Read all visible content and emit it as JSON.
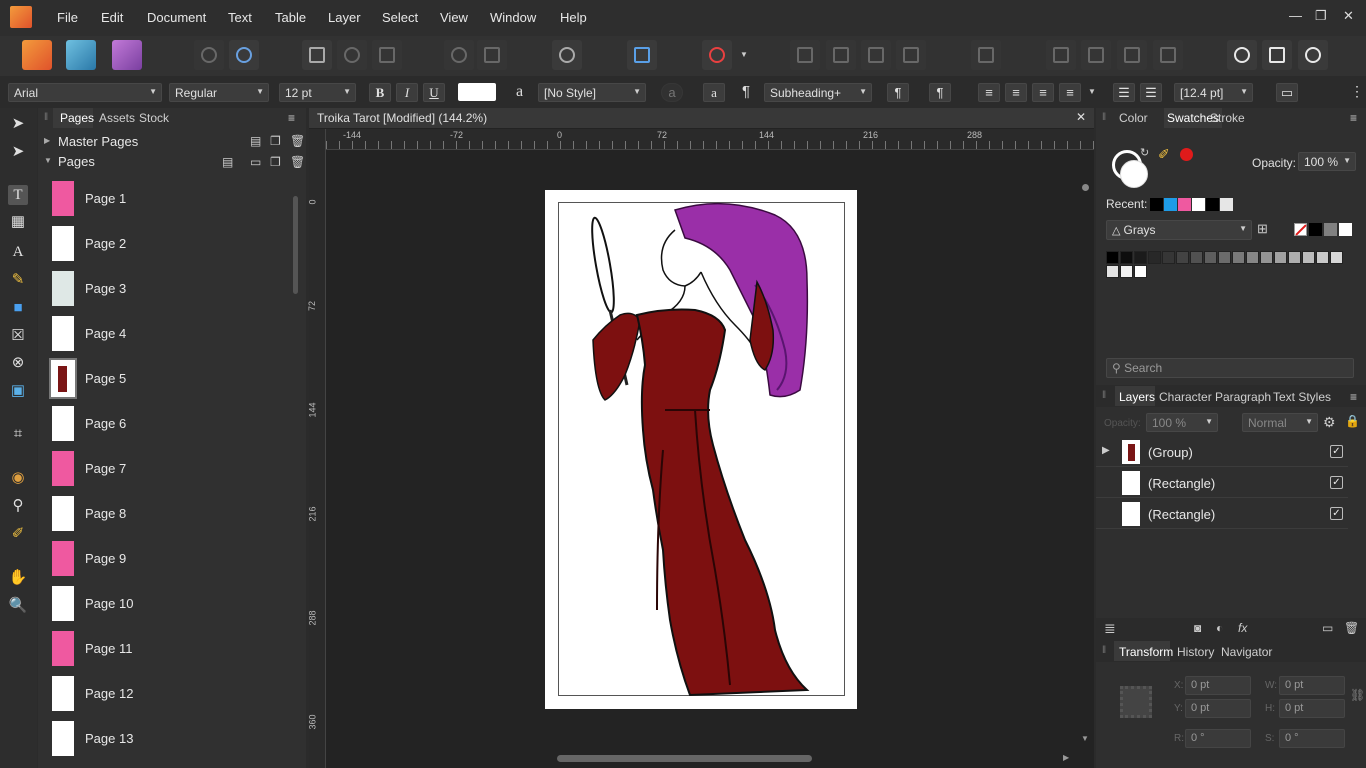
{
  "menu": [
    "File",
    "Edit",
    "Document",
    "Text",
    "Table",
    "Layer",
    "Select",
    "View",
    "Window",
    "Help"
  ],
  "context": {
    "font": "Arial",
    "weight": "Regular",
    "size": "12 pt",
    "bold": "B",
    "italic": "I",
    "underline": "U",
    "char_style_glyph": "a",
    "char_style": "[No Style]",
    "para_style": "Subheading+",
    "pilcrow": "¶",
    "leading": "[12.4 pt]"
  },
  "pages_panel": {
    "tabs": [
      "Pages",
      "Assets",
      "Stock"
    ],
    "master_pages": "Master Pages",
    "pages_heading": "Pages",
    "pages": [
      "Page 1",
      "Page 2",
      "Page 3",
      "Page 4",
      "Page 5",
      "Page 6",
      "Page 7",
      "Page 8",
      "Page 9",
      "Page 10",
      "Page 11",
      "Page 12",
      "Page 13"
    ]
  },
  "document": {
    "title": "Troika Tarot [Modified] (144.2%)",
    "ruler_unit": "pt",
    "h_ticks": [
      "-144",
      "-72",
      "0",
      "72",
      "144",
      "216",
      "288"
    ],
    "v_ticks": [
      "0",
      "72",
      "144",
      "216",
      "288",
      "360"
    ]
  },
  "swatches_panel": {
    "tabs": [
      "Color",
      "Swatches",
      "Stroke"
    ],
    "opacity_label": "Opacity:",
    "opacity_value": "100 %",
    "recent_label": "Recent:",
    "palette": "Grays",
    "search_placeholder": "Search",
    "recent_colors": [
      "#000000",
      "#1e9be6",
      "#ef59a0",
      "#ffffff",
      "#000000",
      "#e6e6e6"
    ],
    "accent": "#e01b1b"
  },
  "layers_panel": {
    "tabs": [
      "Layers",
      "Character",
      "Paragraph",
      "Text Styles"
    ],
    "opacity_label": "Opacity:",
    "opacity_value": "100 %",
    "blend": "Normal",
    "layers": [
      "(Group)",
      "(Rectangle)",
      "(Rectangle)"
    ]
  },
  "transform_panel": {
    "tabs": [
      "Transform",
      "History",
      "Navigator"
    ],
    "x_label": "X:",
    "x": "0 pt",
    "y_label": "Y:",
    "y": "0 pt",
    "w_label": "W:",
    "w": "0 pt",
    "h_label": "H:",
    "h": "0 pt",
    "r_label": "R:",
    "r": "0 °",
    "s_label": "S:",
    "s": "0 °"
  }
}
